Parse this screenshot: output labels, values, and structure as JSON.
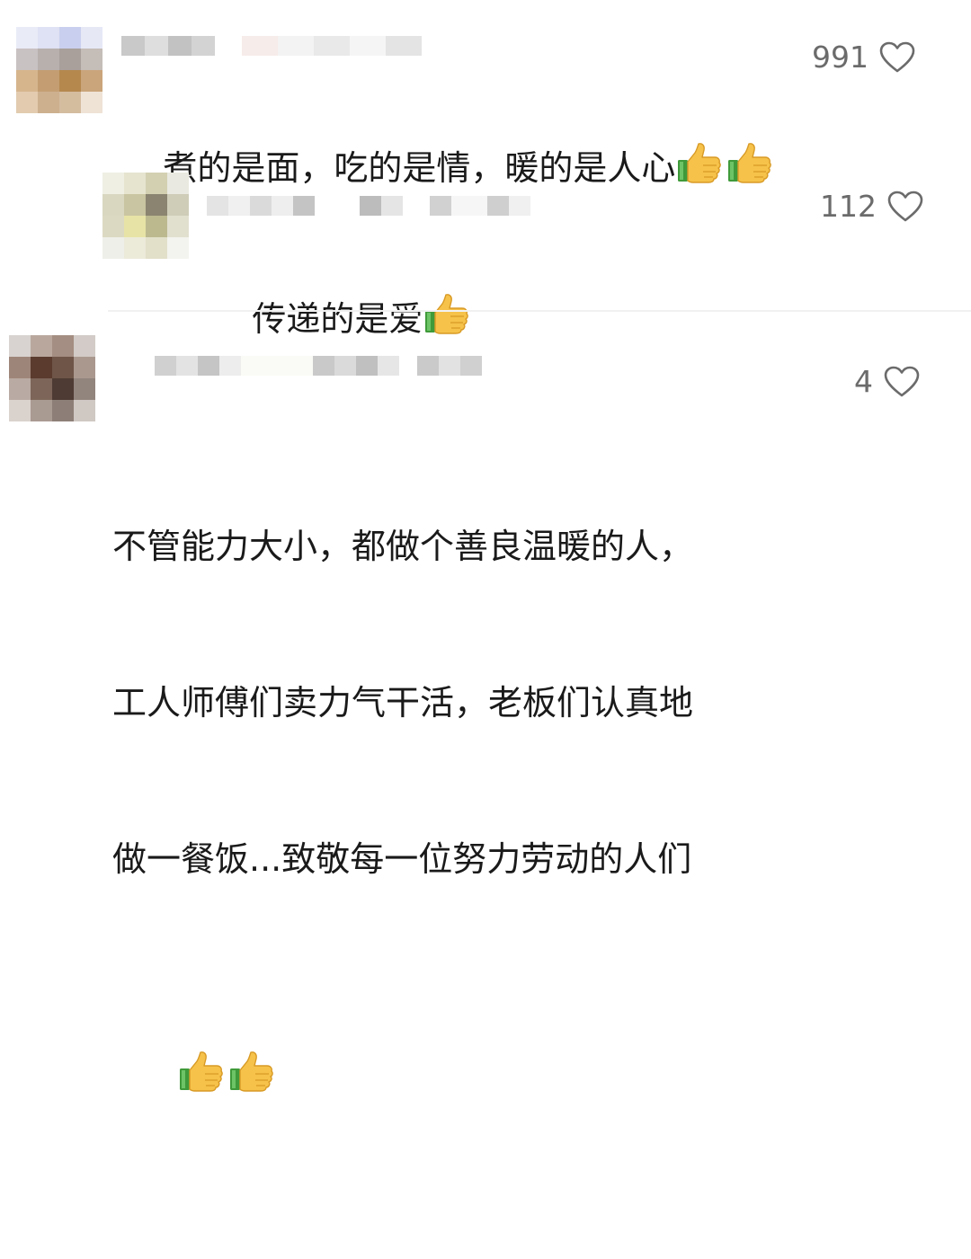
{
  "comments": [
    {
      "likes": "991",
      "text": "煮的是面，吃的是情，暖的是人心",
      "emoji": "thumbs-up-icon",
      "emoji_count": 2
    },
    {
      "likes": "112",
      "text": "传递的是爱",
      "emoji": "thumbs-up-icon",
      "emoji_count": 1,
      "is_reply": true
    },
    {
      "likes": "4",
      "lines": [
        "不管能力大小，都做个善良温暖的人，",
        "工人师傅们卖力气干活，老板们认真地",
        "做一餐饭...致敬每一位努力劳动的人们"
      ],
      "emoji": "thumbs-up-icon",
      "emoji_count": 2
    }
  ],
  "icons": {
    "like": "heart-outline-icon"
  },
  "colors": {
    "like_gray": "#6b6b6b",
    "text": "#1a1a1a"
  }
}
